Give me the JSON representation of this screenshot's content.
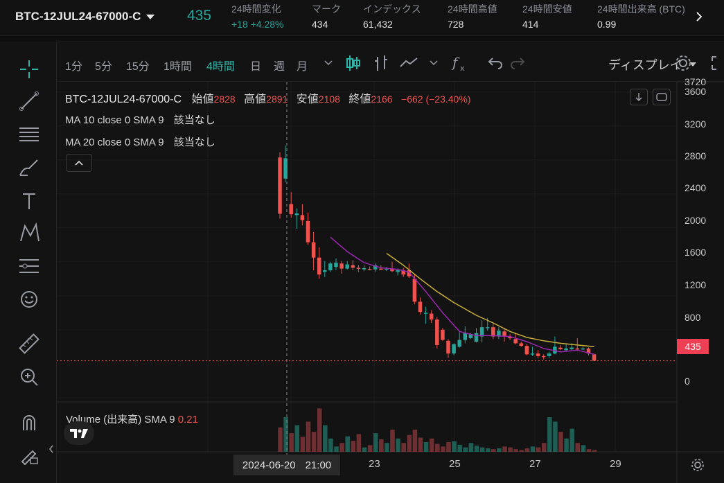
{
  "ticker": {
    "symbol": "BTC-12JUL24-67000-C",
    "last_price": "435",
    "stats": [
      {
        "label": "24時間変化",
        "value": "+18 +4.28%"
      },
      {
        "label": "マーク",
        "value": "434"
      },
      {
        "label": "インデックス",
        "value": "61,432"
      },
      {
        "label": "24時間高値",
        "value": "728"
      },
      {
        "label": "24時間安値",
        "value": "414"
      },
      {
        "label": "24時間出来高 (BTC)",
        "value": "0.99"
      }
    ]
  },
  "toolbar": {
    "timeframes": [
      "1分",
      "5分",
      "15分",
      "1時間",
      "4時間",
      "日",
      "週",
      "月"
    ],
    "active_timeframe": "4時間",
    "display_label": "ディスプレイ"
  },
  "legend": {
    "symbol": "BTC-12JUL24-67000-C",
    "open_label": "始値",
    "open": "2828",
    "high_label": "高値",
    "high": "2891",
    "low_label": "安値",
    "low": "2108",
    "close_label": "終値",
    "close": "2166",
    "change": "−662 (−23.40%)",
    "ma10": "MA 10 close 0 SMA 9",
    "ma20": "MA 20 close 0 SMA 9",
    "na": "該当なし"
  },
  "volume_legend": {
    "label": "Volume (出来高) SMA 9",
    "value": "0.21"
  },
  "price_axis": {
    "ticks": [
      "3720",
      "3600",
      "3200",
      "2800",
      "2400",
      "2000",
      "1600",
      "1200",
      "800",
      "400",
      "0"
    ],
    "current_price": "435"
  },
  "time_axis": {
    "ticks": [
      "23",
      "25",
      "27",
      "29"
    ],
    "crosshair_date": "2024-06-20",
    "crosshair_time": "21:00"
  },
  "colors": {
    "up": "#26a69a",
    "down": "#ef5350",
    "ma10": "#9c27b0",
    "ma20": "#c9b038",
    "accent": "#2fb5a8"
  },
  "chart_data": {
    "type": "candlestick",
    "price_ylim": [
      -50,
      3720
    ],
    "candles": [
      [
        2828,
        2891,
        2108,
        2166
      ],
      [
        2580,
        2970,
        2540,
        2820
      ],
      [
        2280,
        2420,
        2120,
        2160
      ],
      [
        2150,
        2230,
        1990,
        2170
      ],
      [
        2150,
        2280,
        2030,
        2090
      ],
      [
        2080,
        2180,
        1800,
        1830
      ],
      [
        1830,
        1950,
        1500,
        1650
      ],
      [
        1650,
        1770,
        1400,
        1450
      ],
      [
        1480,
        1610,
        1420,
        1500
      ],
      [
        1500,
        1600,
        1480,
        1580
      ],
      [
        1540,
        1640,
        1500,
        1590
      ],
      [
        1580,
        1610,
        1460,
        1520
      ],
      [
        1520,
        1610,
        1510,
        1570
      ],
      [
        1560,
        1620,
        1500,
        1530
      ],
      [
        1530,
        1560,
        1480,
        1520
      ],
      [
        1510,
        1560,
        1490,
        1525
      ],
      [
        1515,
        1545,
        1500,
        1510
      ],
      [
        1510,
        1580,
        1480,
        1560
      ],
      [
        1520,
        1560,
        1500,
        1515
      ],
      [
        1515,
        1540,
        1490,
        1520
      ],
      [
        1520,
        1600,
        1480,
        1490
      ],
      [
        1480,
        1520,
        1440,
        1500
      ],
      [
        1500,
        1530,
        1420,
        1450
      ],
      [
        1500,
        1580,
        1410,
        1430
      ],
      [
        1400,
        1460,
        1100,
        1130
      ],
      [
        1130,
        1180,
        980,
        1010
      ],
      [
        990,
        1070,
        870,
        1000
      ],
      [
        990,
        1030,
        880,
        920
      ],
      [
        920,
        950,
        580,
        620
      ],
      [
        800,
        820,
        670,
        680
      ],
      [
        670,
        690,
        470,
        520
      ],
      [
        520,
        640,
        500,
        630
      ],
      [
        600,
        770,
        590,
        680
      ],
      [
        680,
        840,
        640,
        760
      ],
      [
        700,
        760,
        690,
        750
      ],
      [
        660,
        820,
        650,
        760
      ],
      [
        720,
        910,
        650,
        830
      ],
      [
        830,
        940,
        790,
        830
      ],
      [
        830,
        870,
        690,
        720
      ],
      [
        720,
        830,
        690,
        790
      ],
      [
        780,
        820,
        660,
        720
      ],
      [
        720,
        750,
        680,
        700
      ],
      [
        690,
        760,
        630,
        640
      ],
      [
        640,
        660,
        600,
        610
      ],
      [
        610,
        630,
        500,
        510
      ],
      [
        510,
        600,
        490,
        520
      ],
      [
        520,
        560,
        470,
        490
      ],
      [
        490,
        510,
        450,
        480
      ],
      [
        490,
        540,
        470,
        520
      ],
      [
        520,
        720,
        510,
        600
      ],
      [
        590,
        620,
        560,
        570
      ],
      [
        560,
        630,
        540,
        580
      ],
      [
        570,
        640,
        560,
        590
      ],
      [
        580,
        700,
        550,
        570
      ],
      [
        570,
        600,
        560,
        580
      ],
      [
        580,
        590,
        500,
        520
      ],
      [
        510,
        520,
        430,
        435
      ]
    ],
    "ma10": [
      [
        9,
        1890
      ],
      [
        12,
        1720
      ],
      [
        15,
        1590
      ],
      [
        18,
        1530
      ],
      [
        21,
        1510
      ],
      [
        23,
        1480
      ],
      [
        26,
        1250
      ],
      [
        29,
        1000
      ],
      [
        32,
        780
      ],
      [
        35,
        730
      ],
      [
        38,
        730
      ],
      [
        41,
        720
      ],
      [
        44,
        660
      ],
      [
        47,
        580
      ],
      [
        50,
        540
      ],
      [
        53,
        560
      ],
      [
        56,
        510
      ]
    ],
    "ma20": [
      [
        19,
        1700
      ],
      [
        22,
        1560
      ],
      [
        25,
        1400
      ],
      [
        28,
        1250
      ],
      [
        31,
        1120
      ],
      [
        35,
        970
      ],
      [
        38,
        880
      ],
      [
        41,
        780
      ],
      [
        44,
        710
      ],
      [
        47,
        670
      ],
      [
        50,
        640
      ],
      [
        53,
        620
      ],
      [
        56,
        600
      ]
    ],
    "volume": [
      0.55,
      0.78,
      0.42,
      0.6,
      0.34,
      0.68,
      0.45,
      0.98,
      0.6,
      0.3,
      0.12,
      0.2,
      0.35,
      0.25,
      0.4,
      0.1,
      0.15,
      0.42,
      0.28,
      0.2,
      0.5,
      0.3,
      0.2,
      0.38,
      0.5,
      0.32,
      0.22,
      0.3,
      0.18,
      0.12,
      0.22,
      0.24,
      0.16,
      0.1,
      0.2,
      0.14,
      0.1,
      0.08,
      0.06,
      0.08,
      0.12,
      0.1,
      0.06,
      0.04,
      0.08,
      0.12,
      0.1,
      0.2,
      0.78,
      0.68,
      0.45,
      0.3,
      0.52,
      0.2,
      0.15,
      0.06,
      0.04
    ]
  }
}
